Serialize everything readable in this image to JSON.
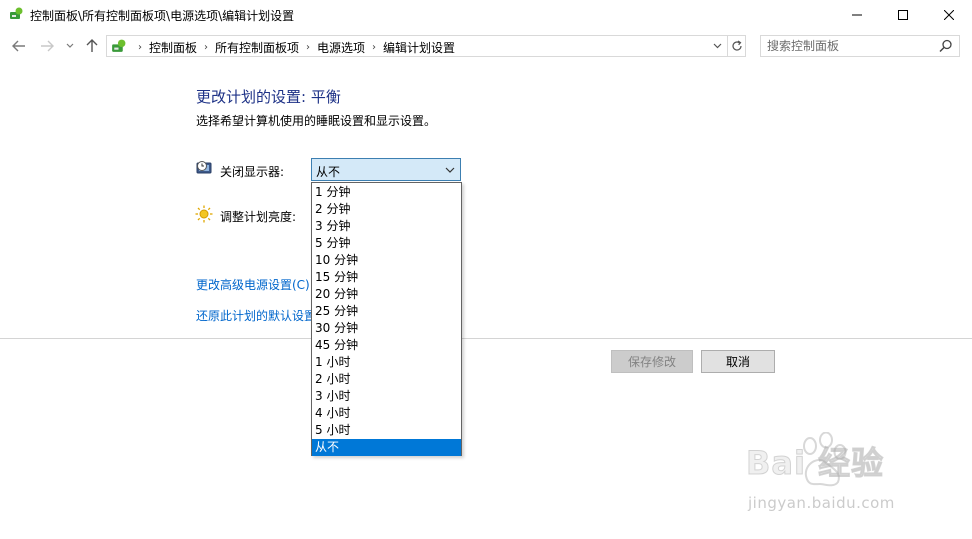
{
  "window": {
    "title": "控制面板\\所有控制面板项\\电源选项\\编辑计划设置"
  },
  "address_bar": {
    "breadcrumbs": [
      "控制面板",
      "所有控制面板项",
      "电源选项",
      "编辑计划设置"
    ]
  },
  "search": {
    "placeholder": "搜索控制面板"
  },
  "main": {
    "heading": "更改计划的设置: 平衡",
    "subheading": "选择希望计算机使用的睡眠设置和显示设置。",
    "display_label": "关闭显示器:",
    "brightness_label": "调整计划亮度:",
    "display_select": {
      "selected": "从不",
      "options": [
        "1 分钟",
        "2 分钟",
        "3 分钟",
        "5 分钟",
        "10 分钟",
        "15 分钟",
        "20 分钟",
        "25 分钟",
        "30 分钟",
        "45 分钟",
        "1 小时",
        "2 小时",
        "3 小时",
        "4 小时",
        "5 小时",
        "从不"
      ],
      "highlighted": "从不"
    },
    "advanced_link": "更改高级电源设置(C)",
    "restore_link": "还原此计划的默认设置"
  },
  "buttons": {
    "save": "保存修改",
    "cancel": "取消"
  },
  "watermark": {
    "brand": "Bai  经验",
    "url": "jingyan.baidu.com"
  },
  "colors": {
    "heading": "#1e3287",
    "link": "#0066cc",
    "selection": "#0078d7",
    "select_bg": "#d4e9f8"
  }
}
